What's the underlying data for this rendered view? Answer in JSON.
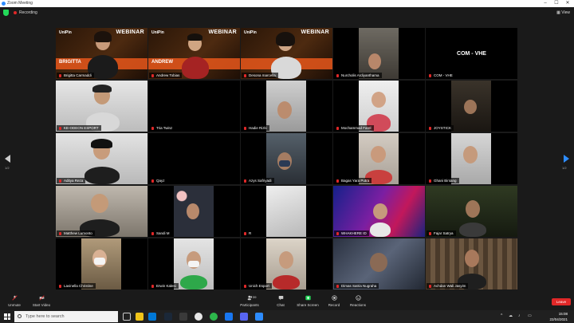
{
  "window": {
    "title": "Zoom Meeting",
    "minimize": "–",
    "maximize": "☐",
    "close": "✕"
  },
  "topbar": {
    "recording_label": "Recording",
    "view_label": "View"
  },
  "gallery": {
    "page_left": "1/2",
    "page_right": "1/2",
    "webinar": {
      "logo_text": "UniPin",
      "title_text": "WEBINAR",
      "tiles": [
        "BRIGITTA",
        "ANDREW",
        ""
      ]
    },
    "centertext": "COM - VHE",
    "participants": [
      "Brigitta Carmaddi",
      "Andrew Tobias",
      "Desona marcella",
      "Nurcholis Ardiyanthama",
      "COM - VHE",
      "KE-ODEON ESPORT",
      "Tria Twinz",
      "Hadie Rizki",
      "Mochammad Farel",
      "JOYSTICK",
      "Aditya Reza",
      "Qayz",
      "Azys Safriyadi",
      "Bagas Yara Putra",
      "Ghani Bintang",
      "Matthew Lumonto",
      "Sandi M",
      "R",
      "WHAKHERE ID",
      "Fajar Satrya",
      "Lavinella Christine",
      "Erwin Kalesi",
      "Unich Esport",
      "Dimas Satria Nugraha",
      "Achdan Wali Jasyim"
    ]
  },
  "toolbar": {
    "unmute": "Unmute",
    "start_video": "Start Video",
    "participants": "Participants",
    "participants_count": "39",
    "chat": "Chat",
    "share_screen": "Share Screen",
    "record": "Record",
    "reactions": "Reactions",
    "leave": "Leave"
  },
  "taskbar": {
    "search_placeholder": "Type here to search",
    "time": "15:08",
    "date": "22/04/2021"
  },
  "colors": {
    "accent_red": "#e02828",
    "zoom_blue": "#2d8cff",
    "share_green": "#23d959",
    "webinar_orange": "#e8571b"
  }
}
